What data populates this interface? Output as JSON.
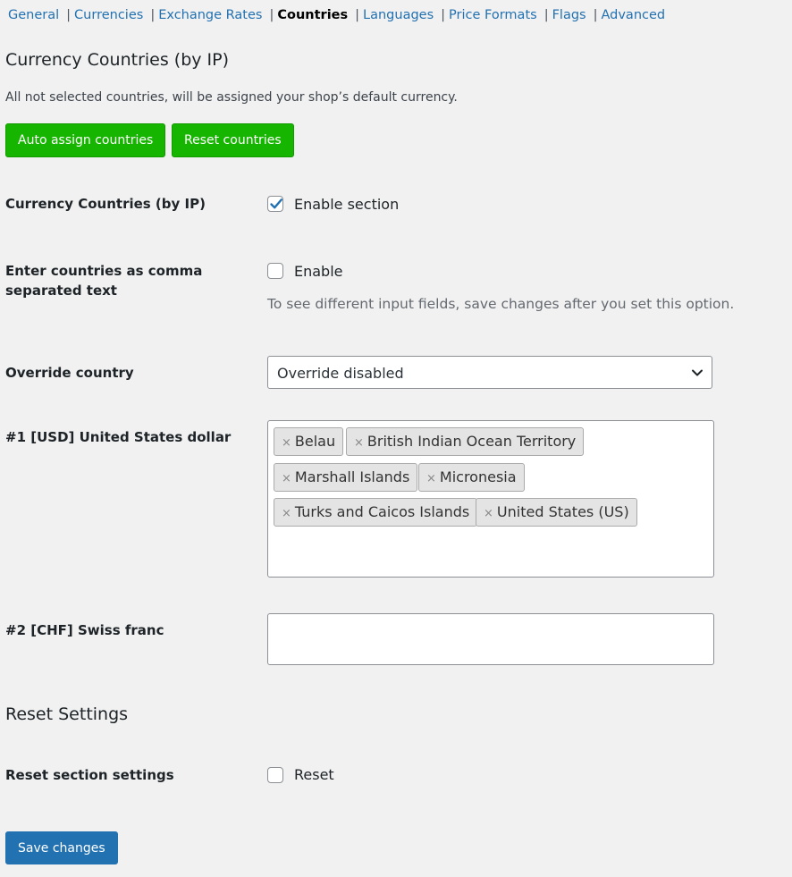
{
  "subnav": {
    "items": [
      {
        "label": "General",
        "current": false
      },
      {
        "label": "Currencies",
        "current": false
      },
      {
        "label": "Exchange Rates",
        "current": false
      },
      {
        "label": "Countries",
        "current": true
      },
      {
        "label": "Languages",
        "current": false
      },
      {
        "label": "Price Formats",
        "current": false
      },
      {
        "label": "Flags",
        "current": false
      },
      {
        "label": "Advanced",
        "current": false
      }
    ],
    "separator": "|"
  },
  "section": {
    "title": "Currency Countries (by IP)",
    "description": "All not selected countries, will be assigned your shop’s default currency.",
    "auto_assign_label": "Auto assign countries",
    "reset_countries_label": "Reset countries"
  },
  "fields": {
    "enable_section": {
      "label": "Currency Countries (by IP)",
      "checkbox_label": "Enable section",
      "checked": true
    },
    "comma_text": {
      "label": "Enter countries as comma separated text",
      "checkbox_label": "Enable",
      "checked": false,
      "hint": "To see different input fields, save changes after you set this option."
    },
    "override_country": {
      "label": "Override country",
      "selected": "Override disabled"
    },
    "usd": {
      "label": "#1 [USD] United States dollar",
      "remove_glyph": "×",
      "chips": [
        "Belau",
        "British Indian Ocean Territory",
        "Marshall Islands",
        "Micronesia",
        "Turks and Caicos Islands",
        "United States (US)"
      ]
    },
    "chf": {
      "label": "#2 [CHF] Swiss franc",
      "value": ""
    }
  },
  "reset": {
    "title": "Reset Settings",
    "label": "Reset section settings",
    "checkbox_label": "Reset",
    "checked": false
  },
  "save_label": "Save changes",
  "colors": {
    "link": "#2271b1",
    "green_button": "#16b500",
    "primary": "#2271b1"
  }
}
